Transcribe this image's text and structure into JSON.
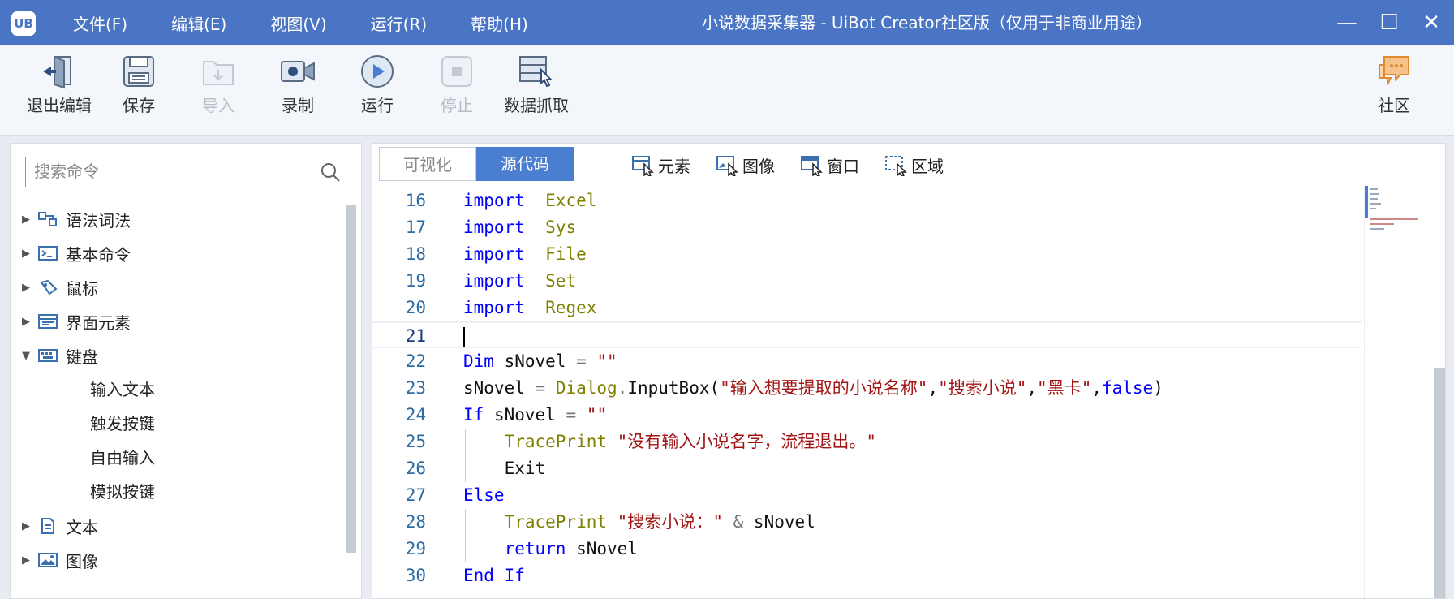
{
  "app": {
    "logo_text": "UB",
    "title": "小说数据采集器 - UiBot Creator社区版（仅用于非商业用途）"
  },
  "menu": [
    "文件(F)",
    "编辑(E)",
    "视图(V)",
    "运行(R)",
    "帮助(H)"
  ],
  "window_controls": {
    "minimize": "—",
    "maximize": "☐",
    "close": "✕"
  },
  "toolbar": {
    "exit_edit": "退出编辑",
    "save": "保存",
    "import": "导入",
    "record": "录制",
    "run": "运行",
    "stop": "停止",
    "data_grab": "数据抓取",
    "community": "社区"
  },
  "sidebar": {
    "search_placeholder": "搜索命令",
    "tree": [
      {
        "label": "语法词法",
        "icon": "syntax-icon",
        "expanded": false
      },
      {
        "label": "基本命令",
        "icon": "terminal-icon",
        "expanded": false
      },
      {
        "label": "鼠标",
        "icon": "mouse-icon",
        "expanded": false
      },
      {
        "label": "界面元素",
        "icon": "ui-element-icon",
        "expanded": false
      },
      {
        "label": "键盘",
        "icon": "keyboard-icon",
        "expanded": true
      },
      {
        "label": "文本",
        "icon": "document-icon",
        "expanded": false
      },
      {
        "label": "图像",
        "icon": "image-icon",
        "expanded": false
      }
    ],
    "keyboard_children": [
      "输入文本",
      "触发按键",
      "自由输入",
      "模拟按键"
    ]
  },
  "editor": {
    "tabs": [
      "可视化",
      "源代码"
    ],
    "active_tab": "源代码",
    "tools": [
      "元素",
      "图像",
      "窗口",
      "区域"
    ],
    "lines": [
      {
        "n": "16",
        "t": [
          [
            "kw",
            "import"
          ],
          [
            "",
            "  "
          ],
          [
            "mod",
            "Excel"
          ]
        ]
      },
      {
        "n": "17",
        "t": [
          [
            "kw",
            "import"
          ],
          [
            "",
            "  "
          ],
          [
            "mod",
            "Sys"
          ]
        ]
      },
      {
        "n": "18",
        "t": [
          [
            "kw",
            "import"
          ],
          [
            "",
            "  "
          ],
          [
            "mod",
            "File"
          ]
        ]
      },
      {
        "n": "19",
        "t": [
          [
            "kw",
            "import"
          ],
          [
            "",
            "  "
          ],
          [
            "mod",
            "Set"
          ]
        ]
      },
      {
        "n": "20",
        "t": [
          [
            "kw",
            "import"
          ],
          [
            "",
            "  "
          ],
          [
            "mod",
            "Regex"
          ]
        ]
      },
      {
        "n": "21",
        "t": []
      },
      {
        "n": "22",
        "t": [
          [
            "kw",
            "Dim"
          ],
          [
            "",
            " sNovel "
          ],
          [
            "op",
            "="
          ],
          [
            "",
            " "
          ],
          [
            "str",
            "\"\""
          ]
        ]
      },
      {
        "n": "23",
        "t": [
          [
            "",
            "sNovel "
          ],
          [
            "op",
            "="
          ],
          [
            "",
            " "
          ],
          [
            "mod",
            "Dialog"
          ],
          [
            "op",
            "."
          ],
          [
            "",
            "InputBox("
          ],
          [
            "str",
            "\"输入想要提取的小说名称\""
          ],
          [
            "",
            ","
          ],
          [
            "str",
            "\"搜索小说\""
          ],
          [
            "",
            ","
          ],
          [
            "str",
            "\"黑卡\""
          ],
          [
            "",
            ","
          ],
          [
            "kw",
            "false"
          ],
          [
            "",
            ")"
          ]
        ]
      },
      {
        "n": "24",
        "t": [
          [
            "kw",
            "If"
          ],
          [
            "",
            " sNovel "
          ],
          [
            "op",
            "="
          ],
          [
            "",
            " "
          ],
          [
            "str",
            "\"\""
          ]
        ]
      },
      {
        "n": "25",
        "t": [
          [
            "",
            "    "
          ],
          [
            "fn",
            "TracePrint"
          ],
          [
            "",
            " "
          ],
          [
            "str",
            "\"没有输入小说名字，流程退出。\""
          ]
        ]
      },
      {
        "n": "26",
        "t": [
          [
            "",
            "    Exit"
          ]
        ]
      },
      {
        "n": "27",
        "t": [
          [
            "kw",
            "Else"
          ]
        ]
      },
      {
        "n": "28",
        "t": [
          [
            "",
            "    "
          ],
          [
            "fn",
            "TracePrint"
          ],
          [
            "",
            " "
          ],
          [
            "str",
            "\"搜索小说：\""
          ],
          [
            "",
            " "
          ],
          [
            "op",
            "&"
          ],
          [
            "",
            " sNovel"
          ]
        ]
      },
      {
        "n": "29",
        "t": [
          [
            "",
            "    "
          ],
          [
            "kw",
            "return"
          ],
          [
            "",
            " sNovel"
          ]
        ]
      },
      {
        "n": "30",
        "t": [
          [
            "kw",
            "End"
          ],
          [
            "",
            " "
          ],
          [
            "kw",
            "If"
          ]
        ]
      }
    ],
    "current_line": "21"
  }
}
